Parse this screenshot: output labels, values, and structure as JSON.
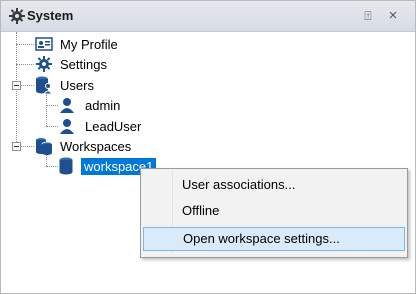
{
  "panel": {
    "title": "System",
    "pin_symbol": "⍐",
    "close_symbol": "×"
  },
  "tree": {
    "items": [
      {
        "label": "My Profile",
        "icon": "profile-card-icon"
      },
      {
        "label": "Settings",
        "icon": "gear-icon"
      },
      {
        "label": "Users",
        "icon": "users-database-icon"
      },
      {
        "label": "admin",
        "icon": "user-icon"
      },
      {
        "label": "LeadUser",
        "icon": "user-icon"
      },
      {
        "label": "Workspaces",
        "icon": "workspaces-database-icon"
      },
      {
        "label": "workspace1",
        "icon": "database-icon",
        "selected": true
      }
    ]
  },
  "context_menu": {
    "items": [
      {
        "label": "User associations..."
      },
      {
        "label": "Offline"
      },
      {
        "label": "Open workspace settings...",
        "highlighted": true
      }
    ]
  },
  "colors": {
    "selection": "#0078d7",
    "menu_highlight": "#d9ebfa",
    "icon_blue": "#1e4f8f"
  }
}
